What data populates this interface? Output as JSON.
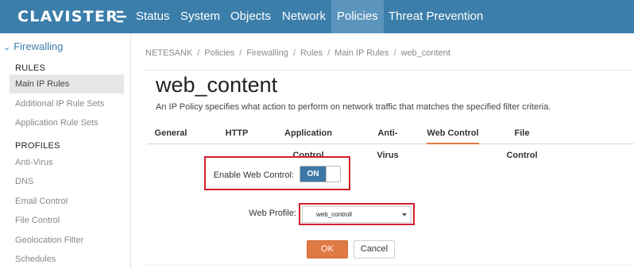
{
  "topnav": {
    "logo_text": "CLAVISTER",
    "items": [
      {
        "label": "Status",
        "active": false
      },
      {
        "label": "System",
        "active": false
      },
      {
        "label": "Objects",
        "active": false
      },
      {
        "label": "Network",
        "active": false
      },
      {
        "label": "Policies",
        "active": true
      },
      {
        "label": "Threat Prevention",
        "active": false
      }
    ],
    "bar_color": "#3c7eaa",
    "active_color": "#5b94bd"
  },
  "sidebar": {
    "header": "Firewalling",
    "sections": [
      {
        "title": "RULES",
        "items": [
          {
            "label": "Main IP Rules",
            "active": true
          },
          {
            "label": "Additional IP Rule Sets",
            "active": false
          },
          {
            "label": "Application Rule Sets",
            "active": false
          }
        ]
      },
      {
        "title": "PROFILES",
        "items": [
          {
            "label": "Anti-Virus",
            "active": false
          },
          {
            "label": "DNS",
            "active": false
          },
          {
            "label": "Email Control",
            "active": false
          },
          {
            "label": "File Control",
            "active": false
          },
          {
            "label": "Geolocation Filter",
            "active": false
          },
          {
            "label": "Schedules",
            "active": false
          }
        ]
      }
    ]
  },
  "breadcrumb": [
    "NETESANK",
    "Policies",
    "Firewalling",
    "Rules",
    "Main IP Rules",
    "web_content"
  ],
  "page": {
    "title": "web_content",
    "description": "An IP Policy specifies what action to perform on network traffic that matches the specified filter criteria."
  },
  "tabs": [
    {
      "label": "General",
      "active": false
    },
    {
      "label": "HTTP",
      "active": false
    },
    {
      "label": "Application Control",
      "active": false
    },
    {
      "label": "Anti-Virus",
      "active": false
    },
    {
      "label": "Web Control",
      "active": true
    },
    {
      "label": "File Control",
      "active": false
    }
  ],
  "form": {
    "enable_label": "Enable Web Control:",
    "toggle_value": "ON",
    "profile_label": "Web Profile:",
    "profile_value": "web_controll"
  },
  "buttons": {
    "ok": "OK",
    "cancel": "Cancel"
  },
  "colors": {
    "accent": "#e07a44",
    "highlight": "#d21f2b",
    "toggle_on": "#3e77a6"
  }
}
